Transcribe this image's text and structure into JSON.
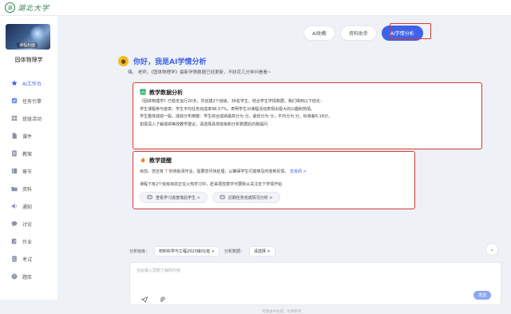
{
  "topbar": {
    "logo_text": "湖北大学",
    "seal_glyph": "湖"
  },
  "sidebar": {
    "cover_tag": "课程封面",
    "course_title": "固体物理学",
    "items": [
      {
        "label": "AI工作台",
        "icon": "ai-workbench-icon",
        "active": true
      },
      {
        "label": "任务引擎",
        "icon": "task-icon",
        "active": false
      },
      {
        "label": "班级活动",
        "icon": "grid-icon",
        "active": false
      },
      {
        "label": "课件",
        "icon": "file-icon",
        "active": false
      },
      {
        "label": "教案",
        "icon": "doc-icon",
        "active": false
      },
      {
        "label": "章节",
        "icon": "chapter-icon",
        "active": false
      },
      {
        "label": "资料",
        "icon": "folder-icon",
        "active": false
      },
      {
        "label": "通知",
        "icon": "speaker-icon",
        "active": false
      },
      {
        "label": "讨论",
        "icon": "chat-icon",
        "active": false
      },
      {
        "label": "作业",
        "icon": "edit-icon",
        "active": false
      },
      {
        "label": "考试",
        "icon": "exam-icon",
        "active": false
      },
      {
        "label": "题库",
        "icon": "question-bank-icon",
        "active": false
      }
    ]
  },
  "tabs": [
    {
      "label": "AI助教",
      "active": false
    },
    {
      "label": "资料助手",
      "active": false
    },
    {
      "label": "AI学情分析",
      "active": true
    }
  ],
  "greeting": {
    "title": "你好，我是AI学情分析",
    "subtitle": "嗨，       老师，《固体物理学》最新学情数据已经更新，不妨花几分钟问看看~"
  },
  "analysis_card": {
    "title": "教学数据分析",
    "lines": [
      "《固体物理学》已稳定运行20天，共创建2个班级，36名学生，结合学生学情数据，我们得到以下结论：",
      "学生课程参与度高：学生平均任务完成率98.57%，表明学生对课程活动表现出极大的兴趣和热情。",
      "学生整体成绩一般，成绩分布离散：学生综合成绩最高分为     分，最低分为     分，平均分为     分，标准差6.16分。",
      "如需深入了解成绩等改教学建议，请选择具体班级和分析数据后向我提问"
    ]
  },
  "reminder_card": {
    "title": "教学提醒",
    "p1_before": "目前，您还有",
    "p1_count": "7",
    "p1_after": "份待批阅作业，需要您尽快处理，以确保学生们能够及时收到反馈。",
    "p1_link": "去批阅 >",
    "p2": "课程下有2个班级目前正在火热学习中，赶来把控数字可要默从关注去下学情开始",
    "btn1": "查看学习进度落后学生 >",
    "btn2": "近期任务完成情况分析 >"
  },
  "filter": {
    "class_label": "分析班级：",
    "class_value": "材料科学与工程2023级01班 >",
    "data_label": "分析数据：",
    "data_value": "请选择 >"
  },
  "input": {
    "placeholder": "在此输入您想了解的内容",
    "send_label": "发送"
  },
  "footer": {
    "text": "内容由AI生成，仅供参考"
  },
  "colors": {
    "accent": "#3f62e8",
    "highlight_border": "#d43a36",
    "brand_green": "#2e7d4f",
    "warn_red": "#e53935"
  }
}
